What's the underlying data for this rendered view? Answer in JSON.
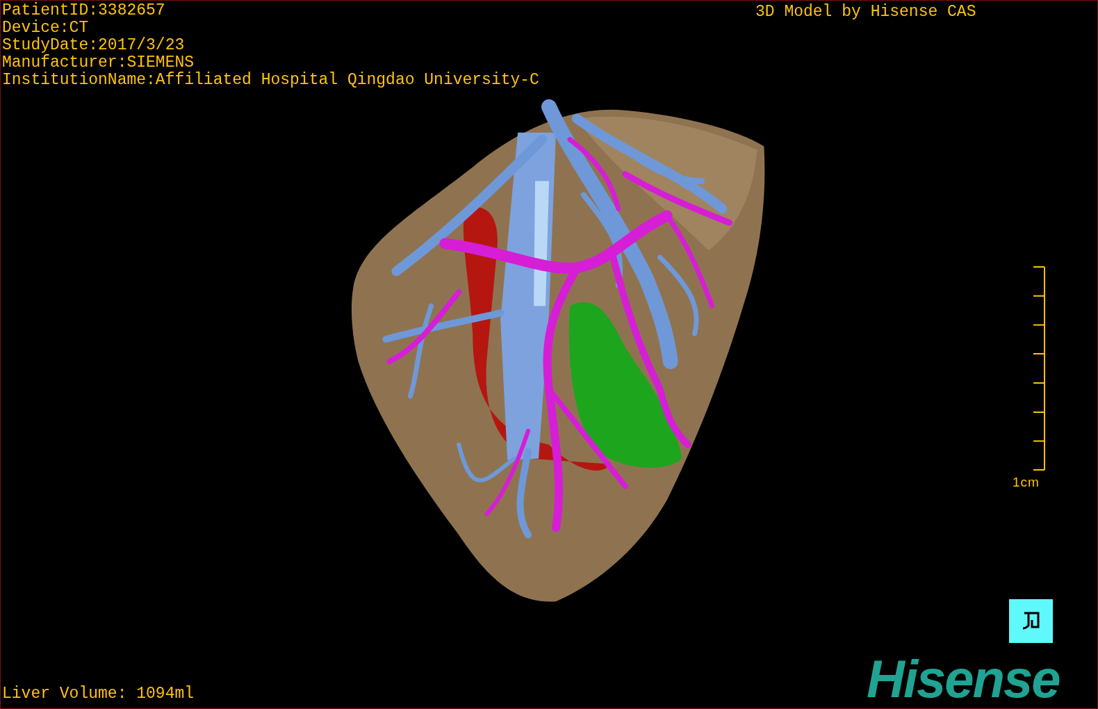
{
  "study_info": [
    "PatientID:3382657",
    "Device:CT",
    "StudyDate:2017/3/23",
    "Manufacturer:SIEMENS",
    "InstitutionName:Affiliated Hospital Qingdao University-C"
  ],
  "model_credit": "3D Model by Hisense CAS",
  "scale_bar": {
    "label": "1cm"
  },
  "liver_volume": "Liver Volume: 1094ml",
  "brand_logo": "Hisense"
}
